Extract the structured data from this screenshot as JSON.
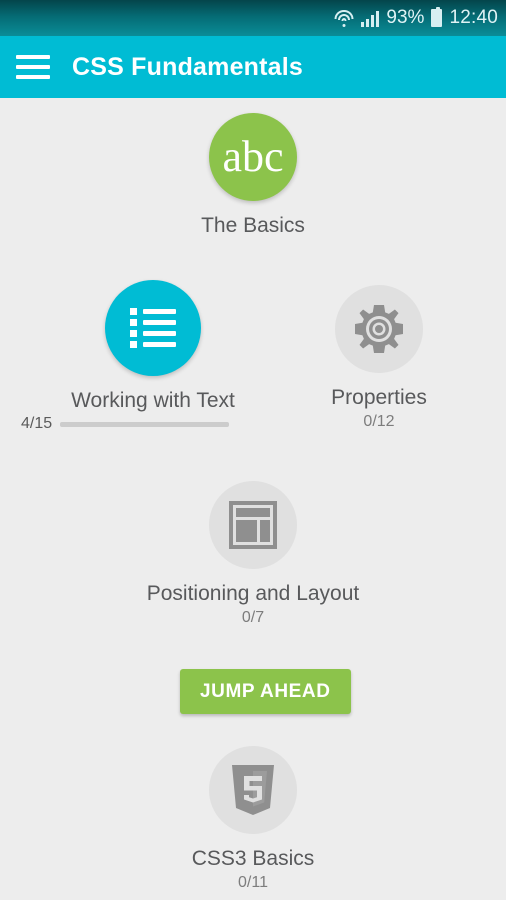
{
  "status_bar": {
    "wifi_icon": "wifi-icon",
    "signal_icon": "signal-icon",
    "battery_percent": "93%",
    "battery_icon": "battery-icon",
    "time": "12:40"
  },
  "action_bar": {
    "menu_icon": "hamburger-menu-icon",
    "title": "CSS Fundamentals",
    "background_color": "#00bcd4"
  },
  "theme": {
    "page_background": "#ededed",
    "accent_cyan": "#00bcd4",
    "accent_green": "#8cc34b",
    "inactive_grey": "#e0e0e0",
    "icon_grey": "#8f8f8f",
    "label_color": "#58595b"
  },
  "nodes": [
    {
      "id": "the-basics",
      "label": "The Basics",
      "icon": "abc-text-icon",
      "icon_text": "abc",
      "state": "completed",
      "circle_color": "#8cc34b",
      "count": ""
    },
    {
      "id": "working-with-text",
      "label": "Working with Text",
      "icon": "bulleted-list-icon",
      "state": "in-progress",
      "circle_color": "#00bcd4",
      "progress_text": "4/15",
      "progress_completed": 4,
      "progress_total": 15,
      "progress_percent": 27
    },
    {
      "id": "properties",
      "label": "Properties",
      "icon": "gear-icon",
      "state": "locked",
      "circle_color": "#e0e0e0",
      "count": "0/12"
    },
    {
      "id": "positioning-and-layout",
      "label": "Positioning and Layout",
      "icon": "page-layout-icon",
      "state": "locked",
      "circle_color": "#e0e0e0",
      "count": "0/7"
    },
    {
      "id": "css3-basics",
      "label": "CSS3 Basics",
      "icon": "css3-shield-icon",
      "state": "locked",
      "circle_color": "#e0e0e0",
      "count": "0/11"
    }
  ],
  "jump_ahead_button": {
    "label": "JUMP AHEAD",
    "color": "#8cc34b"
  }
}
